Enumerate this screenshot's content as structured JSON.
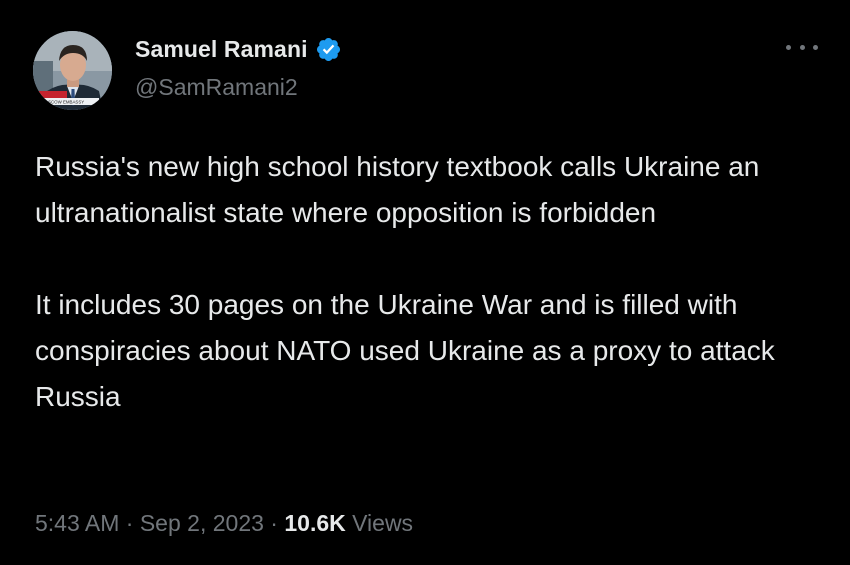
{
  "author": {
    "display_name": "Samuel Ramani",
    "handle": "@SamRamani2",
    "verified": true,
    "avatar_caption": "MOSCOW EMBASSY"
  },
  "tweet": {
    "paragraph_1": "Russia's new high school history textbook calls Ukraine an ultranationalist state where opposition is forbidden",
    "paragraph_2": "It includes 30 pages on the Ukraine War and is filled with conspiracies about NATO used Ukraine as a proxy to attack Russia",
    "time": "5:43 AM",
    "separator": "·",
    "date": "Sep 2, 2023",
    "views_count": "10.6K",
    "views_label": "Views"
  },
  "icons": {
    "verified_badge": "verified-badge-icon",
    "more_menu": "more-options-icon"
  },
  "colors": {
    "background": "#000000",
    "primary_text": "#e7e9ea",
    "secondary_text": "#71767b",
    "verified_blue": "#1d9bf0"
  }
}
